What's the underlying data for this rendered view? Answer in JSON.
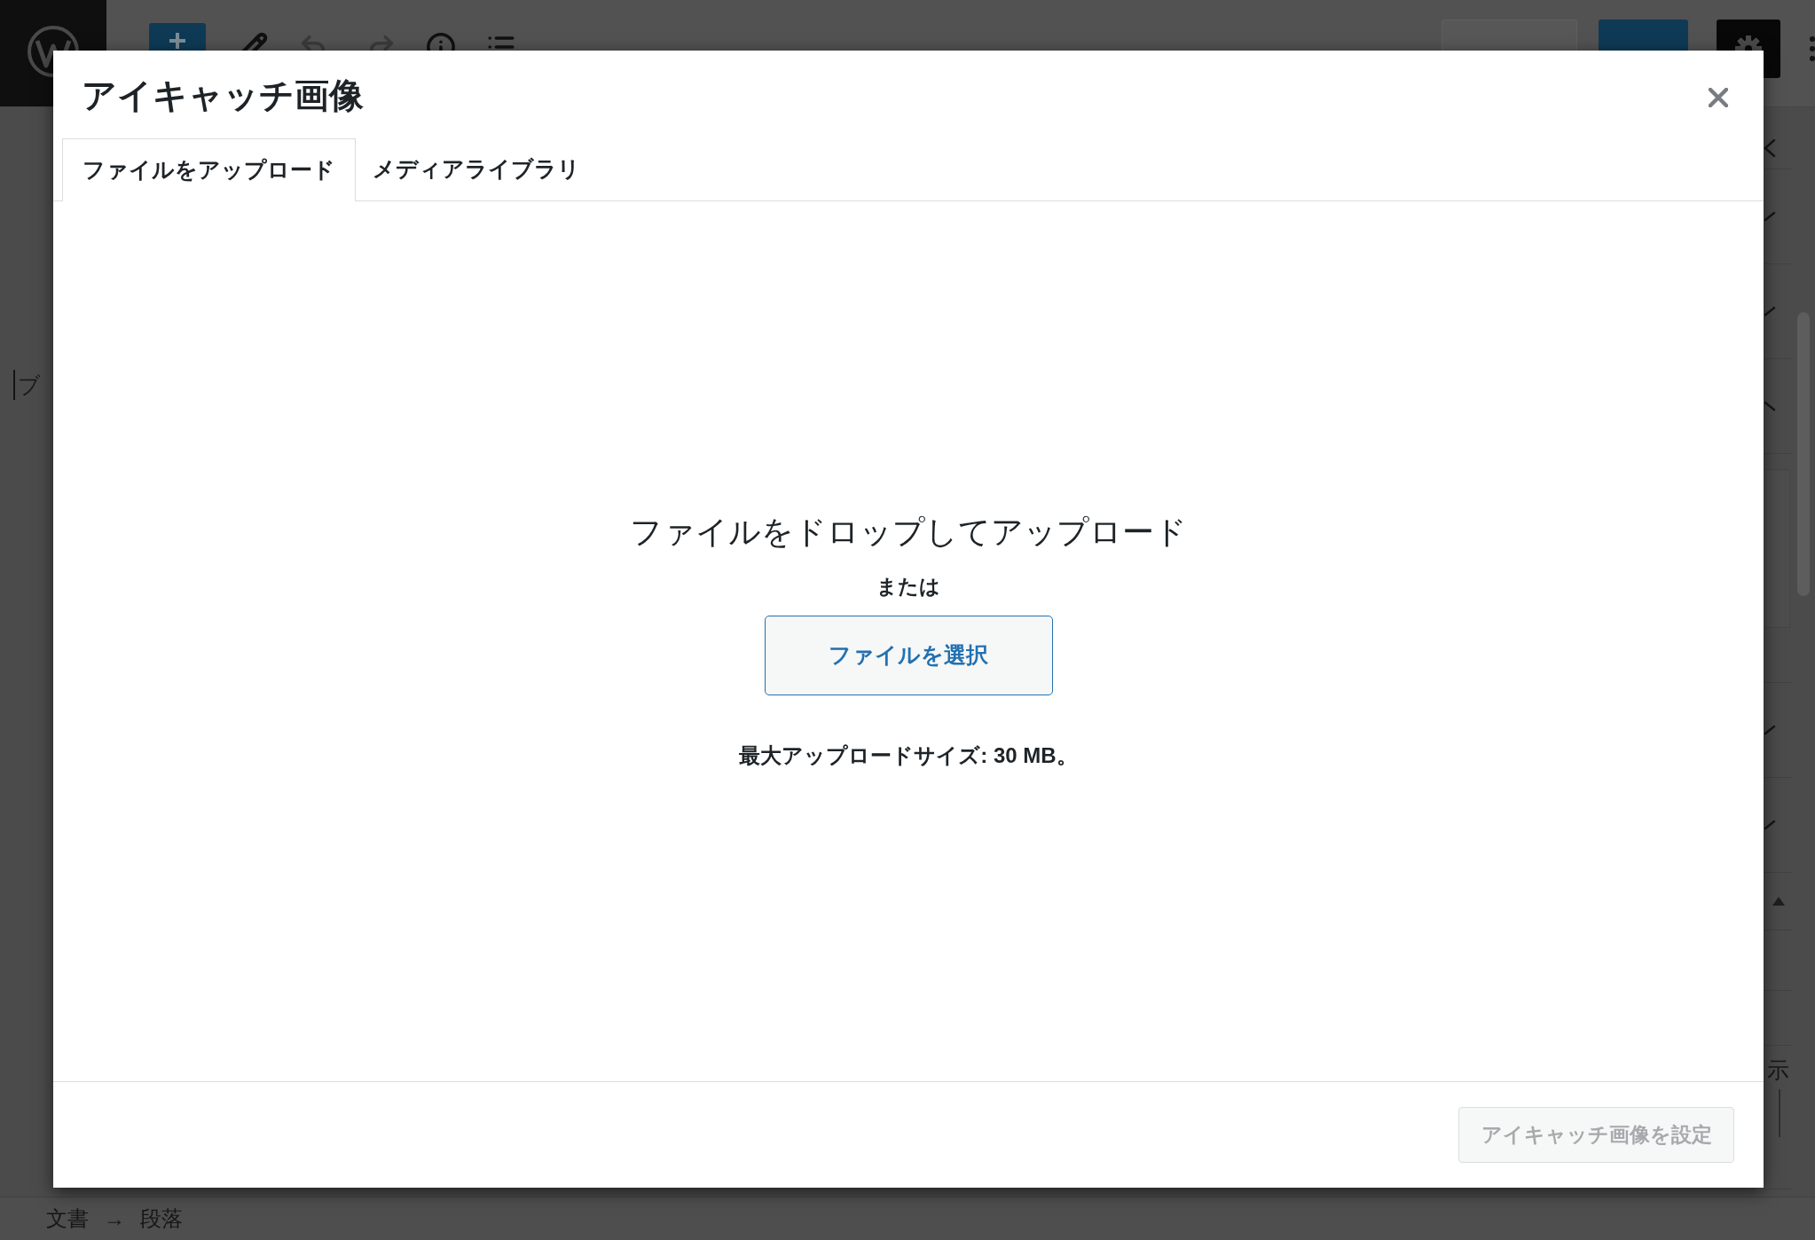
{
  "toolbar": {
    "undo": {
      "disabled": true
    },
    "redo": {
      "disabled": true
    }
  },
  "editor": {
    "paragraph": {
      "placeholder": "ブ"
    },
    "breadcrumb": {
      "items": [
        "文書",
        "段落"
      ],
      "separator": "→"
    }
  },
  "sidebar": {
    "panels": [
      {
        "expanded": false
      },
      {
        "expanded": false
      },
      {
        "expanded": true
      },
      {
        "expanded": false
      },
      {
        "expanded": false
      }
    ],
    "label": "示"
  },
  "modal": {
    "title": "アイキャッチ画像",
    "tabs": [
      {
        "label": "ファイルをアップロード",
        "selected": true
      },
      {
        "label": "メディアライブラリ",
        "selected": false
      }
    ],
    "uploader": {
      "instructions": "ファイルをドロップしてアップロード",
      "separator": "または",
      "select_button": "ファイルを選択",
      "max_size": "最大アップロードサイズ: 30 MB。"
    },
    "footer": {
      "set_button": {
        "label": "アイキャッチ画像を設定",
        "disabled": true
      }
    }
  }
}
